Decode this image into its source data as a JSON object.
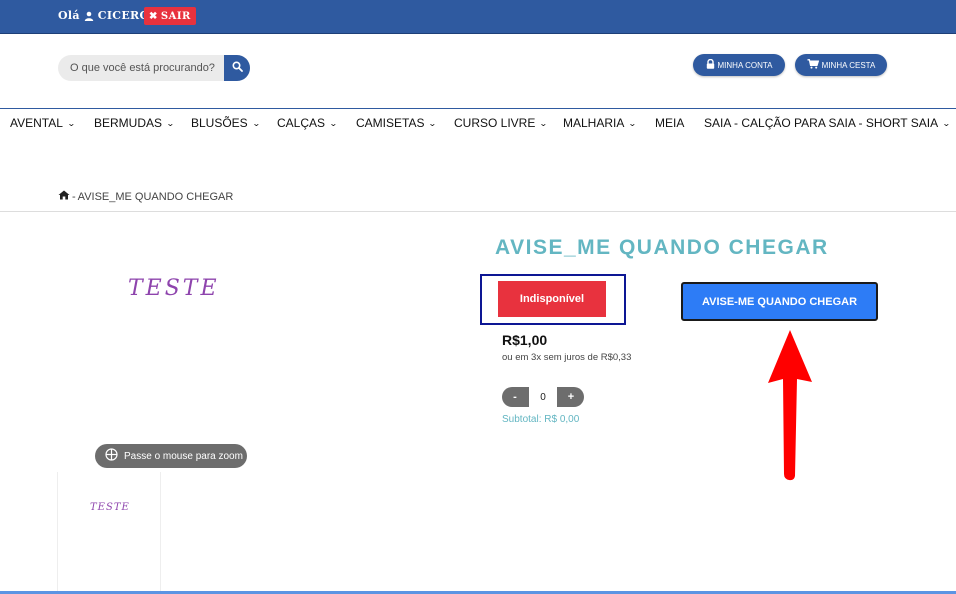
{
  "header": {
    "greeting_prefix": "Olá",
    "username": "CICERO",
    "logout_label": "SAIR"
  },
  "search": {
    "placeholder": "O que você está procurando?"
  },
  "account": {
    "my_account_label": "MINHA CONTA",
    "my_basket_label": "MINHA CESTA"
  },
  "menu": {
    "items": [
      {
        "label": "AVENTAL",
        "has_dropdown": true
      },
      {
        "label": "BERMUDAS",
        "has_dropdown": true
      },
      {
        "label": "BLUSÕES",
        "has_dropdown": true
      },
      {
        "label": "CALÇAS",
        "has_dropdown": true
      },
      {
        "label": "CAMISETAS",
        "has_dropdown": true
      },
      {
        "label": "CURSO LIVRE",
        "has_dropdown": true
      },
      {
        "label": "MALHARIA",
        "has_dropdown": true
      },
      {
        "label": "MEIA",
        "has_dropdown": false
      },
      {
        "label": "SAIA - CALÇÃO PARA SAIA - SHORT SAIA",
        "has_dropdown": true
      }
    ]
  },
  "breadcrumb": {
    "current": "AVISE_ME QUANDO CHEGAR"
  },
  "gallery": {
    "main_image_text": "TESTE",
    "zoom_hint": "Passe o mouse para zoom",
    "thumbnail_text": "TESTE"
  },
  "product": {
    "title": "AVISE_ME QUANDO CHEGAR",
    "status_label": "Indisponível",
    "notify_label": "AVISE-ME QUANDO CHEGAR",
    "price": "R$1,00",
    "installments": "ou em 3x sem juros de R$0,33",
    "quantity": "0",
    "qty_minus": "-",
    "qty_plus": "+",
    "subtotal": "Subtotal: R$ 0,00"
  },
  "colors": {
    "brand_blue": "#2f5aa0",
    "danger_red": "#e8323e",
    "cta_blue": "#2d7cf6",
    "teal_title": "#63b6c2",
    "highlight_navy": "#0d1694",
    "annotation_arrow_red": "#ff0000"
  }
}
